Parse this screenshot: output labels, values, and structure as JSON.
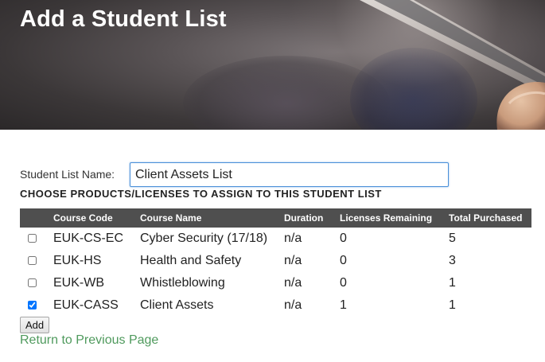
{
  "header": {
    "title": "Add a Student List"
  },
  "form": {
    "name_label": "Student List Name:",
    "name_value": "Client Assets List",
    "section_heading": "CHOOSE PRODUCTS/LICENSES TO ASSIGN TO THIS STUDENT LIST"
  },
  "table": {
    "columns": [
      "",
      "Course Code",
      "Course Name",
      "Duration",
      "Licenses Remaining",
      "Total Purchased"
    ],
    "rows": [
      {
        "checked": false,
        "code": "EUK-CS-EC",
        "name": "Cyber Security (17/18)",
        "duration": "n/a",
        "remaining": "0",
        "purchased": "5"
      },
      {
        "checked": false,
        "code": "EUK-HS",
        "name": "Health and Safety",
        "duration": "n/a",
        "remaining": "0",
        "purchased": "3"
      },
      {
        "checked": false,
        "code": "EUK-WB",
        "name": "Whistleblowing",
        "duration": "n/a",
        "remaining": "0",
        "purchased": "1"
      },
      {
        "checked": true,
        "code": "EUK-CASS",
        "name": "Client Assets",
        "duration": "n/a",
        "remaining": "1",
        "purchased": "1"
      }
    ]
  },
  "actions": {
    "add_label": "Add",
    "return_label": "Return to Previous Page"
  },
  "colors": {
    "header_row": "#4f4f4f",
    "link": "#4f9a5d",
    "input_focus": "#4a90d9"
  }
}
